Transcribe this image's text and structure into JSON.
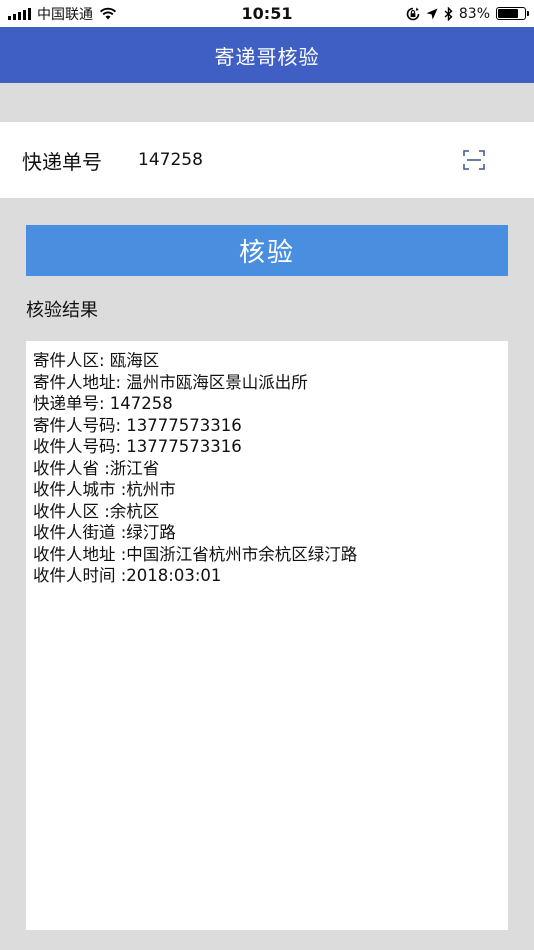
{
  "status_bar": {
    "carrier": "中国联通",
    "time": "10:51",
    "battery": "83%",
    "battery_level": 0.83
  },
  "nav": {
    "title": "寄递哥核验"
  },
  "tracking": {
    "label": "快递单号",
    "value": "147258"
  },
  "verify_button": {
    "label": "核验"
  },
  "result": {
    "title": "核验结果",
    "lines": [
      "寄件人区: 瓯海区",
      "寄件人地址: 温州市瓯海区景山派出所",
      "快递单号: 147258",
      "寄件人号码: 13777573316",
      "收件人号码: 13777573316",
      "收件人省 :浙江省",
      "收件人城市 :杭州市",
      "收件人区 :余杭区",
      "收件人街道 :绿汀路",
      "收件人地址 :中国浙江省杭州市余杭区绿汀路",
      "收件人时间 :2018:03:01"
    ]
  },
  "colors": {
    "nav_bg": "#3f5fc4",
    "button_bg": "#4a8fdf",
    "page_bg": "#dcdcdc"
  },
  "icons": {
    "scan": "scan-icon",
    "wifi": "wifi-icon",
    "location": "location-arrow-icon",
    "bluetooth": "bluetooth-icon",
    "rotation_lock": "rotation-lock-icon"
  }
}
